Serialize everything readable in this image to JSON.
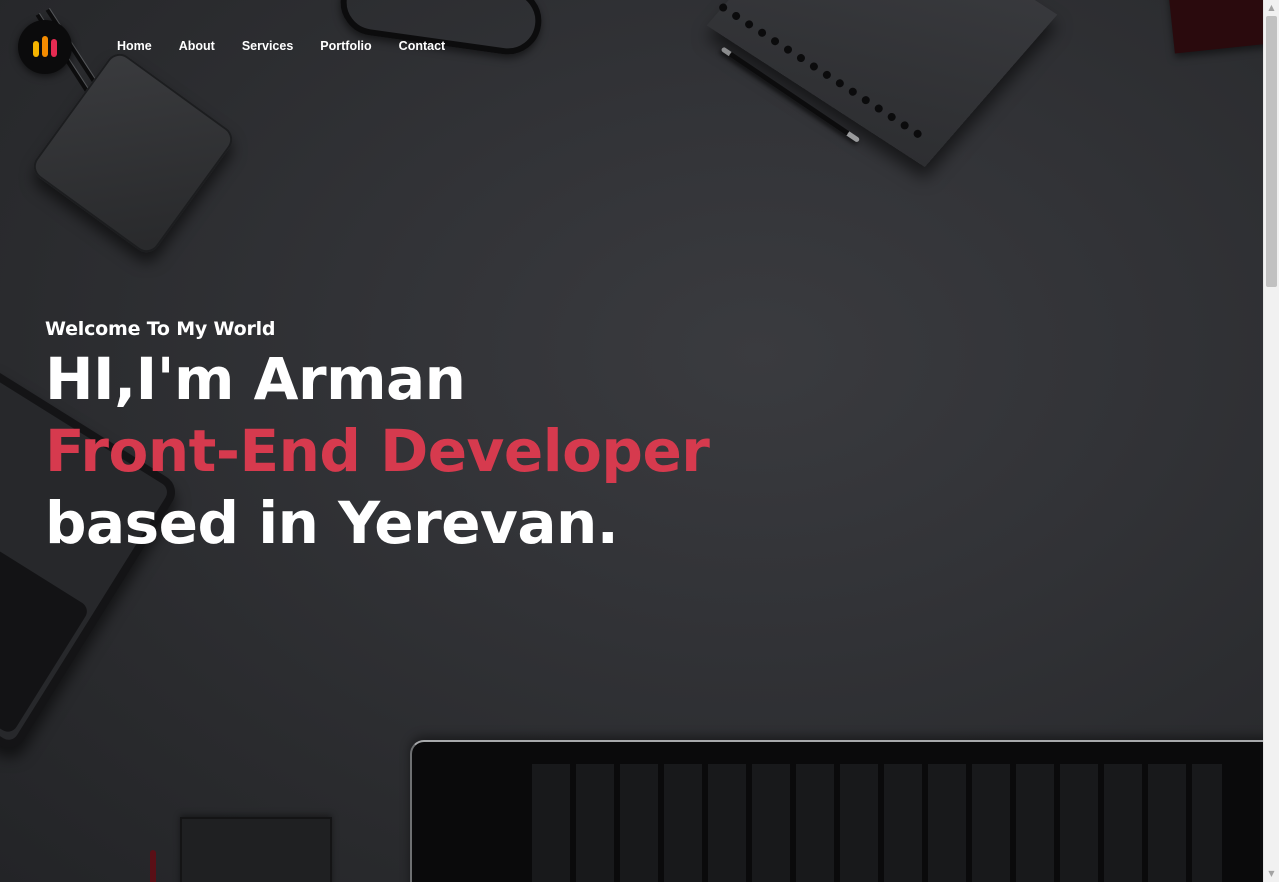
{
  "nav": {
    "items": [
      {
        "label": "Home"
      },
      {
        "label": "About"
      },
      {
        "label": "Services"
      },
      {
        "label": "Portfolio"
      },
      {
        "label": "Contact"
      }
    ]
  },
  "logo": {
    "icon": "bar-chart-logo-icon",
    "colors": [
      "#f5b400",
      "#f38b00",
      "#e52b52"
    ]
  },
  "hero": {
    "welcome": "Welcome To My World",
    "greeting": "HI,I'm Arman",
    "role": "Front-End Developer",
    "location": "based in Yerevan."
  },
  "theme": {
    "accent": "#d63a4e",
    "text": "#ffffff",
    "background": "#2f3033"
  },
  "scrollbar": {
    "up_icon": "scroll-up-arrow-icon",
    "down_icon": "scroll-down-arrow-icon"
  }
}
